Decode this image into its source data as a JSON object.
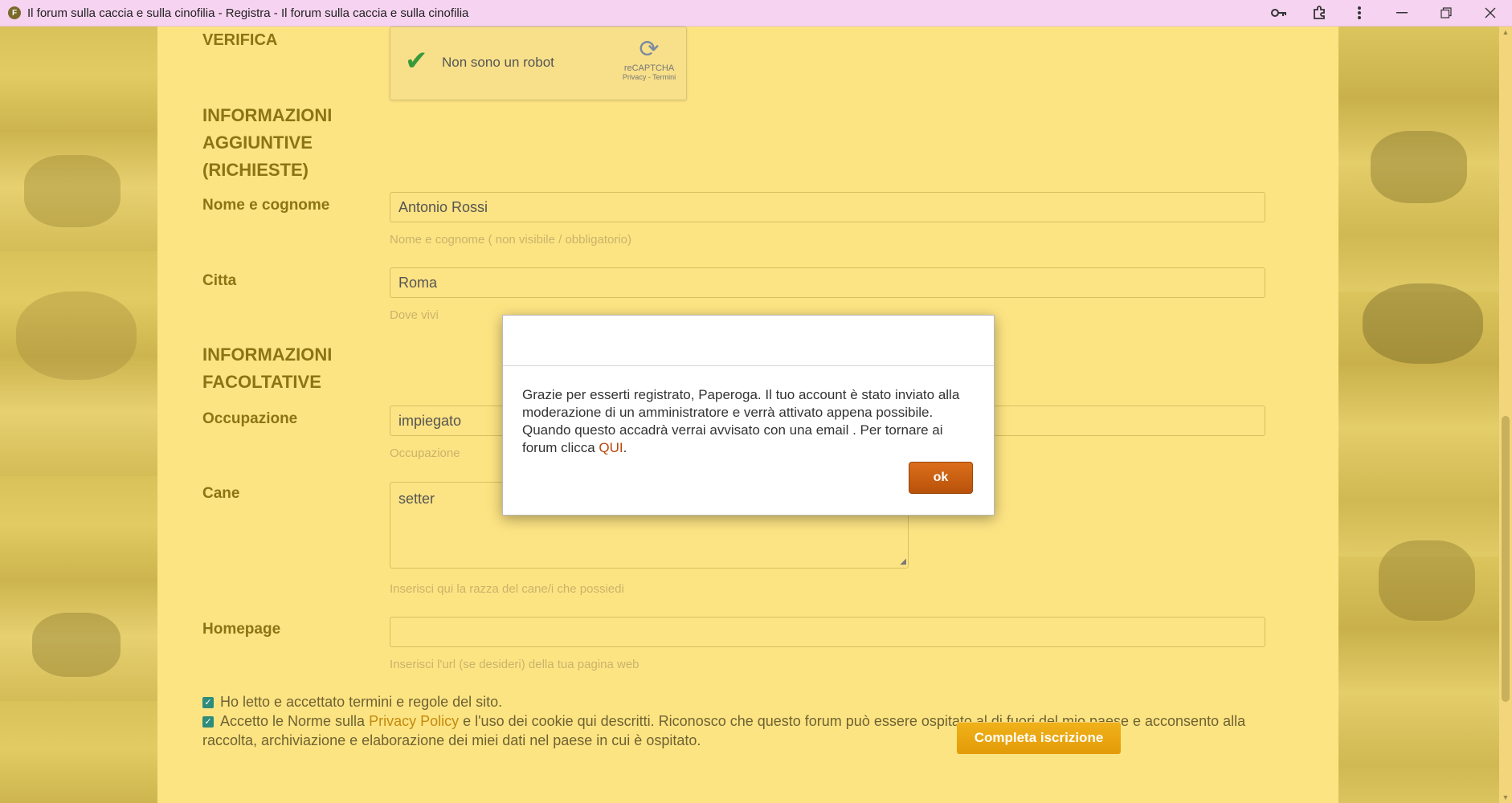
{
  "window": {
    "title": "Il forum sulla caccia e sulla cinofilia - Registra - Il forum sulla caccia e sulla cinofilia",
    "favicon_text": "F"
  },
  "sections": {
    "verifica": "VERIFICA",
    "aggiuntive_line1": "INFORMAZIONI",
    "aggiuntive_line2": "AGGIUNTIVE",
    "aggiuntive_line3": "(RICHIESTE)",
    "facoltative_line1": "INFORMAZIONI",
    "facoltative_line2": "FACOLTATIVE"
  },
  "captcha": {
    "label": "Non sono un robot",
    "brand": "reCAPTCHA",
    "links": "Privacy - Termini"
  },
  "fields": {
    "nome": {
      "label": "Nome e cognome",
      "value": "Antonio Rossi",
      "hint": "Nome e cognome ( non visibile / obbligatorio)"
    },
    "citta": {
      "label": "Citta",
      "value": "Roma",
      "hint": "Dove vivi"
    },
    "occupazione": {
      "label": "Occupazione",
      "value": "impiegato",
      "hint": "Occupazione"
    },
    "cane": {
      "label": "Cane",
      "value": "setter",
      "hint": "Inserisci qui la razza del cane/i che possiedi"
    },
    "homepage": {
      "label": "Homepage",
      "value": "",
      "hint": "Inserisci l'url (se desideri) della tua pagina web"
    }
  },
  "consent": {
    "terms": "Ho letto e accettato termini e regole del sito.",
    "privacy_before": "Accetto le Norme sulla ",
    "privacy_link": "Privacy Policy",
    "privacy_after": " e l'uso dei cookie qui descritti. Riconosco che questo forum può essere ospitato al di fuori del mio paese e acconsento alla raccolta, archiviazione e elaborazione dei miei dati nel paese in cui è ospitato."
  },
  "submit_label": "Completa iscrizione",
  "modal": {
    "message": "Grazie per esserti registrato, Paperoga. Il tuo account è stato inviato alla moderazione di un amministratore e verrà attivato appena possibile. Quando questo accadrà verrai avvisato con una email . Per tornare ai forum clicca ",
    "link": "QUI",
    "after": ".",
    "ok_label": "ok"
  }
}
